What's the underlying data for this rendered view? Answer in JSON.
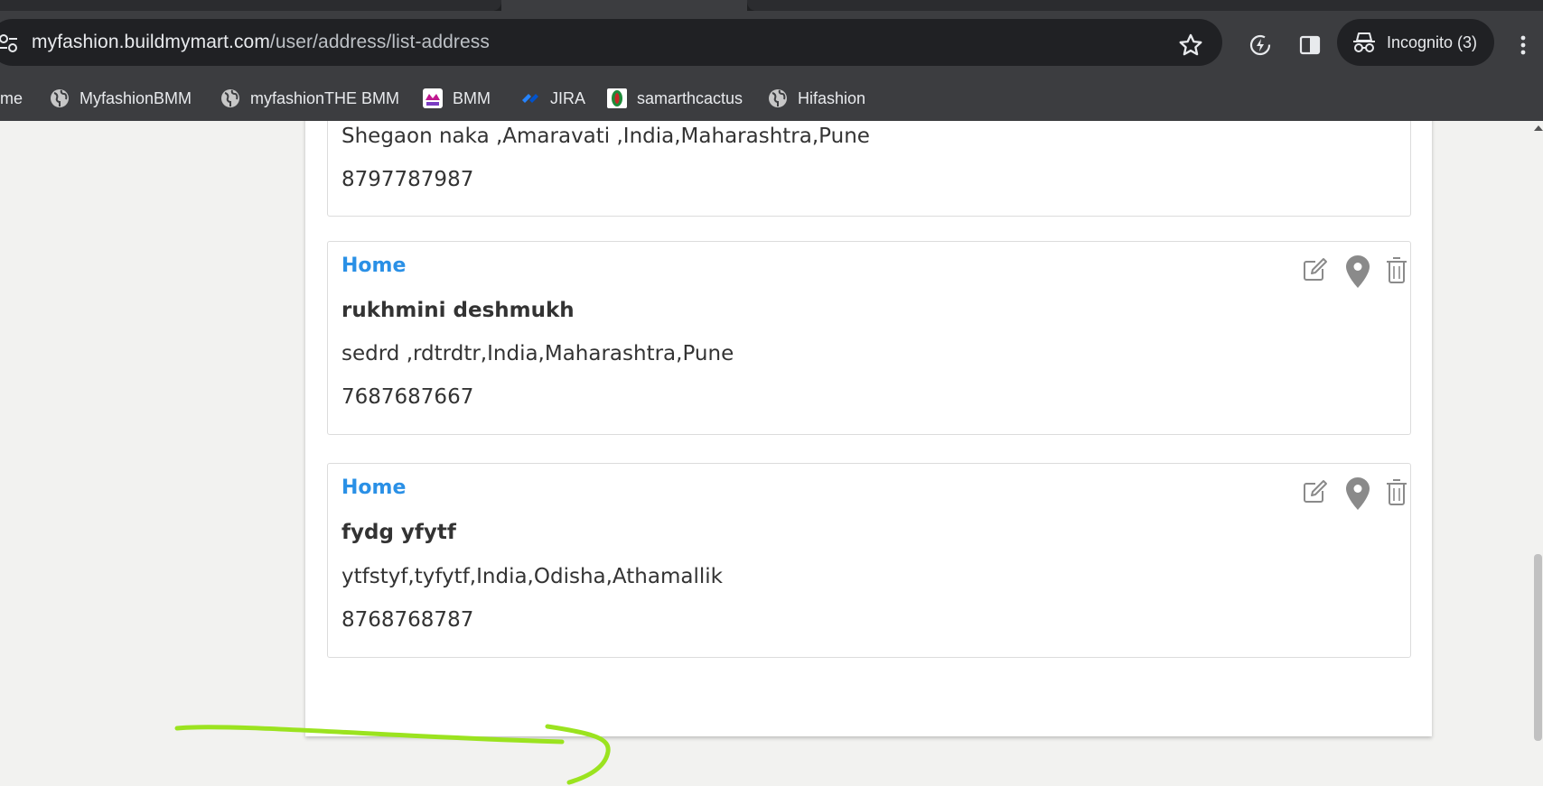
{
  "browser": {
    "url_host": "myfashion.buildmymart.com",
    "url_path": "/user/address/list-address",
    "incognito_label": "Incognito (3)",
    "bookmarks": [
      {
        "label": "me",
        "icon": "none"
      },
      {
        "label": "MyfashionBMM",
        "icon": "globe-icon"
      },
      {
        "label": "myfashionTHE BMM",
        "icon": "globe-icon"
      },
      {
        "label": "BMM",
        "icon": "bmm-logo-icon"
      },
      {
        "label": "JIRA",
        "icon": "jira-icon"
      },
      {
        "label": "samarthcactus",
        "icon": "cactus-icon"
      },
      {
        "label": "Hifashion",
        "icon": "globe-icon"
      }
    ]
  },
  "addresses": [
    {
      "type": "",
      "name": "",
      "address": "Shegaon naka ,Amaravati ,India,Maharashtra,Pune",
      "phone": "8797787987"
    },
    {
      "type": "Home",
      "name": "rukhmini deshmukh",
      "address": "sedrd ,rdtrdtr,India,Maharashtra,Pune",
      "phone": "7687687667"
    },
    {
      "type": "Home",
      "name": "fydg yfytf",
      "address": "ytfstyf,tyfytf,India,Odisha,Athamallik",
      "phone": "8768768787"
    }
  ],
  "colors": {
    "accent_blue": "#2a90e6",
    "text_dark": "#333333",
    "icon_gray": "#8a8a8a",
    "annotation_green": "#9be31f",
    "chrome_dark": "#202124"
  }
}
